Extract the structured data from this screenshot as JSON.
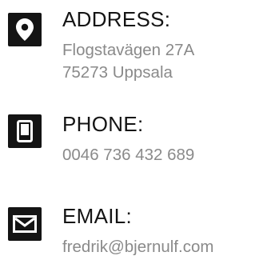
{
  "contact": {
    "address": {
      "icon": "location-pin-icon",
      "heading": "ADDRESS:",
      "line1": "Flogstavägen 27A",
      "line2": "75273 Uppsala"
    },
    "phone": {
      "icon": "mobile-phone-icon",
      "heading": "PHONE:",
      "line1": "0046 736 432 689"
    },
    "email": {
      "icon": "envelope-icon",
      "heading": "EMAIL:",
      "line1": "fredrik@bjernulf.com"
    }
  },
  "colors": {
    "icon_background": "#141414",
    "heading_text": "#141414",
    "detail_text": "#8a8a8a"
  }
}
